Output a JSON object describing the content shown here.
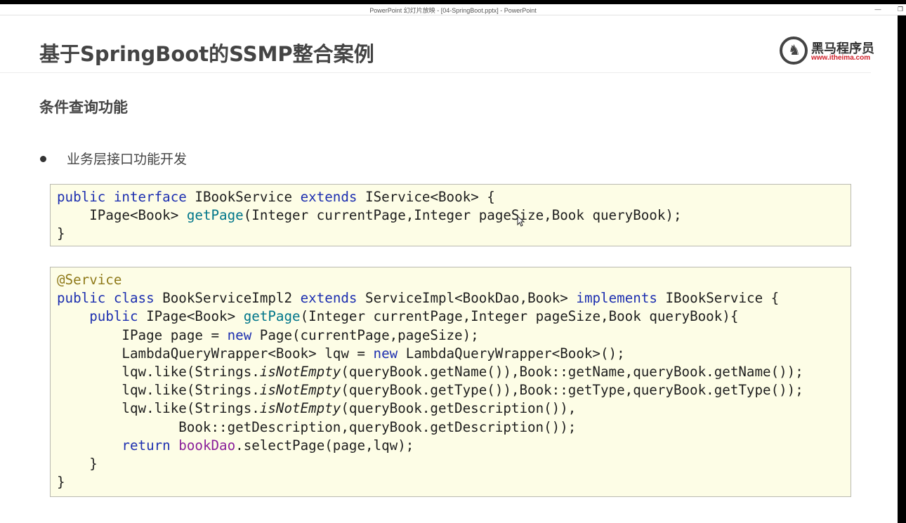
{
  "window": {
    "title": "PowerPoint 幻灯片放映 - [04-SpringBoot.pptx] - PowerPoint",
    "minimize_glyph": "—",
    "restore_glyph": "❐"
  },
  "slide": {
    "title": "基于SpringBoot的SSMP整合案例",
    "section_heading": "条件查询功能",
    "bullet": "业务层接口功能开发",
    "logo": {
      "name": "黑马程序员",
      "url": "www.itheima.com"
    }
  },
  "code": {
    "interface": {
      "l1": {
        "kw1": "public",
        "kw2": "interface",
        "name": "IBookService",
        "kw3": "extends",
        "rest": "IService<Book> {"
      },
      "l2": {
        "indent": "    ",
        "type": "IPage<Book> ",
        "method": "getPage",
        "params": "(Integer currentPage,Integer pageSize,Book queryBook);"
      },
      "l3": {
        "text": "}"
      }
    },
    "impl": {
      "l1": {
        "text": "@Service"
      },
      "l2": {
        "kw1": "public",
        "kw2": "class",
        "name": "BookServiceImpl2",
        "kw3": "extends",
        "mid": "ServiceImpl<BookDao,Book>",
        "kw4": "implements",
        "rest": "IBookService {"
      },
      "l3": {
        "indent": "    ",
        "kw": "public",
        "type": " IPage<Book> ",
        "method": "getPage",
        "params": "(Integer currentPage,Integer pageSize,Book queryBook){"
      },
      "l4": {
        "pre": "        IPage page = ",
        "kw": "new",
        "post": " Page(currentPage,pageSize);"
      },
      "l5": {
        "pre": "        LambdaQueryWrapper<Book> lqw = ",
        "kw": "new",
        "post": " LambdaQueryWrapper<Book>();"
      },
      "l6": {
        "pre": "        lqw.like(Strings.",
        "italic": "isNotEmpty",
        "post": "(queryBook.getName()),Book::getName,queryBook.getName());"
      },
      "l7": {
        "pre": "        lqw.like(Strings.",
        "italic": "isNotEmpty",
        "post": "(queryBook.getType()),Book::getType,queryBook.getType());"
      },
      "l8": {
        "pre": "        lqw.like(Strings.",
        "italic": "isNotEmpty",
        "post": "(queryBook.getDescription()),"
      },
      "l9": {
        "text": "               Book::getDescription,queryBook.getDescription());"
      },
      "l10": {
        "indent": "        ",
        "kw": "return",
        "field": "bookDao",
        "post": ".selectPage(page,lqw);"
      },
      "l11": {
        "text": "    }"
      },
      "l12": {
        "text": "}"
      }
    }
  },
  "colors": {
    "keyword": "#1d2fb0",
    "annotation": "#8f7a1a",
    "method": "#00768a",
    "field": "#8a1f9a",
    "code_background": "#fdfde6"
  }
}
